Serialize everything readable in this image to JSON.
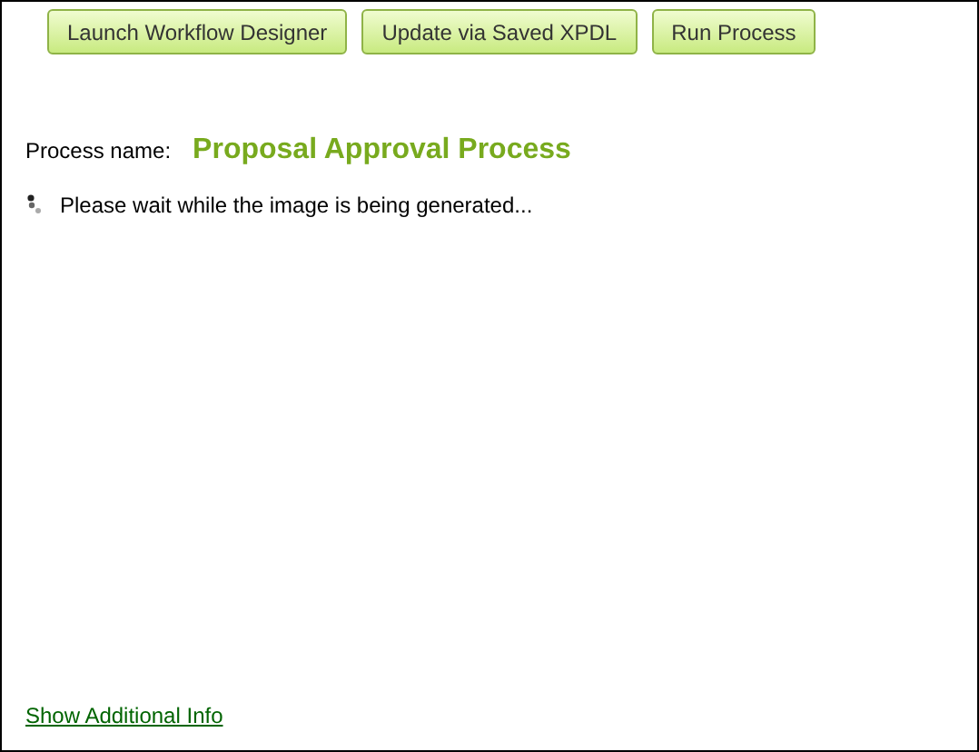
{
  "buttons": [
    {
      "label": "Launch Workflow Designer"
    },
    {
      "label": "Update via Saved XPDL"
    },
    {
      "label": "Run Process"
    }
  ],
  "process": {
    "label": "Process name:",
    "name": "Proposal Approval Process"
  },
  "status": {
    "message": "Please wait while the image is being generated..."
  },
  "footer_link": "Show Additional Info"
}
